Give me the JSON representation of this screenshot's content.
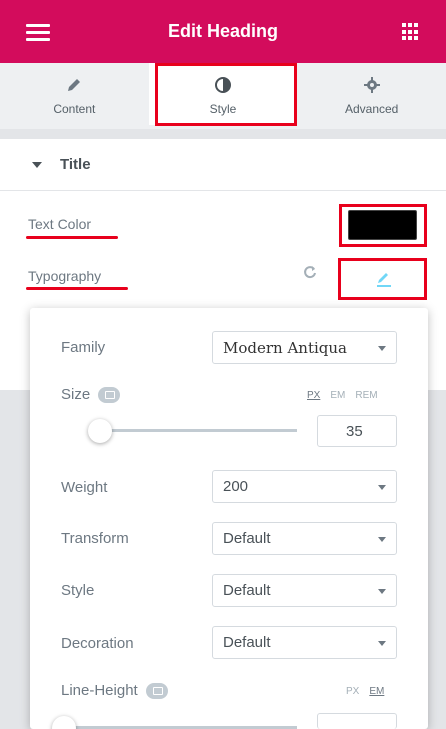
{
  "header": {
    "title": "Edit Heading"
  },
  "tabs": [
    {
      "label": "Content",
      "icon": "pencil-icon"
    },
    {
      "label": "Style",
      "icon": "contrast-icon"
    },
    {
      "label": "Advanced",
      "icon": "gear-icon"
    }
  ],
  "section": {
    "title": "Title"
  },
  "controls": {
    "text_color_label": "Text Color",
    "text_color_value": "#000000",
    "typography_label": "Typography"
  },
  "typography": {
    "family_label": "Family",
    "family_value": "Modern Antiqua",
    "size_label": "Size",
    "size_units": [
      "PX",
      "EM",
      "REM"
    ],
    "size_value": "35",
    "weight_label": "Weight",
    "weight_value": "200",
    "transform_label": "Transform",
    "transform_value": "Default",
    "style_label": "Style",
    "style_value": "Default",
    "decoration_label": "Decoration",
    "decoration_value": "Default",
    "line_height_label": "Line-Height",
    "line_height_units": [
      "PX",
      "EM"
    ]
  },
  "colors": {
    "brand": "#d30c5c",
    "highlight": "#e8001c",
    "accent": "#71d7f7"
  }
}
